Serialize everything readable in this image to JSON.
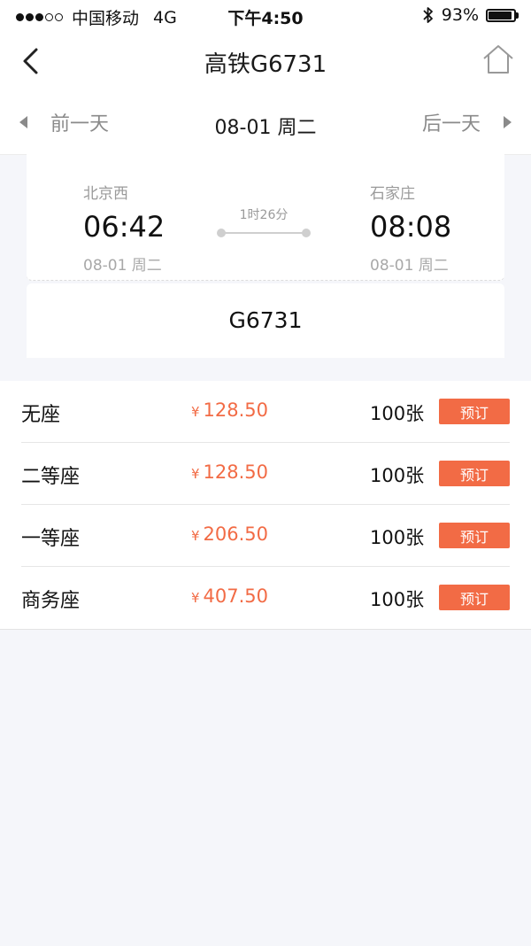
{
  "status_bar": {
    "carrier": "中国移动",
    "network": "4G",
    "time": "下午4:50",
    "battery": "93%",
    "battery_level": 0.93
  },
  "nav": {
    "title": "高铁G6731",
    "back_icon": "chevron-left-icon",
    "home_icon": "home-icon"
  },
  "date_bar": {
    "prev_label": "前一天",
    "current_date": "08-01 周二",
    "next_label": "后一天"
  },
  "journey": {
    "from_station": "北京西",
    "from_time": "06:42",
    "from_date": "08-01 周二",
    "duration": "1时26分",
    "to_station": "石家庄",
    "to_time": "08:08",
    "to_date": "08-01 周二"
  },
  "train_number": "G6731",
  "seats": [
    {
      "type": "无座",
      "currency": "¥",
      "price": "128.50",
      "count": "100张",
      "book_label": "预订"
    },
    {
      "type": "二等座",
      "currency": "¥",
      "price": "128.50",
      "count": "100张",
      "book_label": "预订"
    },
    {
      "type": "一等座",
      "currency": "¥",
      "price": "206.50",
      "count": "100张",
      "book_label": "预订"
    },
    {
      "type": "商务座",
      "currency": "¥",
      "price": "407.50",
      "count": "100张",
      "book_label": "预订"
    }
  ],
  "colors": {
    "accent": "#f26b45",
    "background": "#f5f6fa"
  }
}
